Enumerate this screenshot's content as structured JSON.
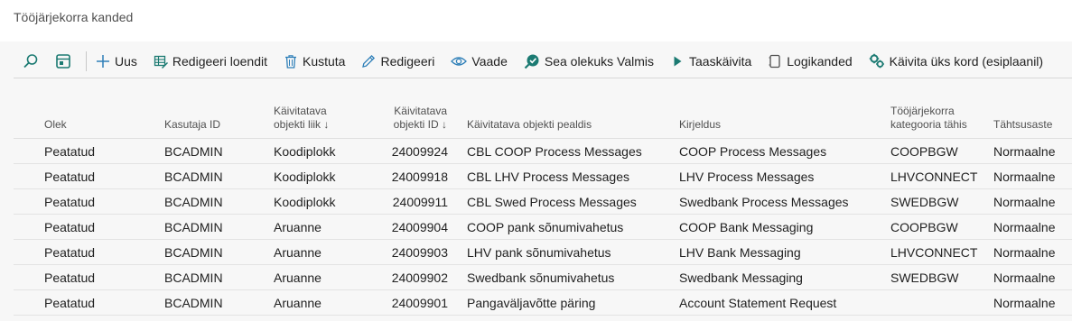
{
  "page": {
    "title": "Tööjärjekorra kanded"
  },
  "toolbar": {
    "search_icon": "search-icon",
    "view_icon": "page-view-icon",
    "buttons": [
      {
        "label": "Uus",
        "icon": "plus-icon"
      },
      {
        "label": "Redigeeri loendit",
        "icon": "edit-list-icon"
      },
      {
        "label": "Kustuta",
        "icon": "trash-icon"
      },
      {
        "label": "Redigeeri",
        "icon": "pencil-icon"
      },
      {
        "label": "Vaade",
        "icon": "eye-icon"
      },
      {
        "label": "Sea olekuks Valmis",
        "icon": "status-ready-icon"
      },
      {
        "label": "Taaskäivita",
        "icon": "play-icon"
      },
      {
        "label": "Logikanded",
        "icon": "log-icon"
      },
      {
        "label": "Käivita üks kord (esiplaanil)",
        "icon": "run-once-icon"
      }
    ]
  },
  "grid": {
    "columns": {
      "status": "Olek",
      "user_id": "Kasutaja ID",
      "object_type_1": "Käivitatava",
      "object_type_2": "objekti liik ↓",
      "object_id_1": "Käivitatava",
      "object_id_2": "objekti ID ↓",
      "object_caption": "Käivitatava objekti pealdis",
      "description": "Kirjeldus",
      "category_1": "Tööjärjekorra",
      "category_2": "kategooria tähis",
      "priority": "Tähtsusaste"
    },
    "rows": [
      {
        "status": "Peatatud",
        "user_id": "BCADMIN",
        "object_type": "Koodiplokk",
        "object_id": "24009924",
        "object_caption": "CBL COOP Process Messages",
        "description": "COOP Process Messages",
        "category": "COOPBGW",
        "priority": "Normaalne"
      },
      {
        "status": "Peatatud",
        "user_id": "BCADMIN",
        "object_type": "Koodiplokk",
        "object_id": "24009918",
        "object_caption": "CBL LHV Process Messages",
        "description": "LHV Process Messages",
        "category": "LHVCONNECT",
        "priority": "Normaalne"
      },
      {
        "status": "Peatatud",
        "user_id": "BCADMIN",
        "object_type": "Koodiplokk",
        "object_id": "24009911",
        "object_caption": "CBL Swed Process Messages",
        "description": "Swedbank Process Messages",
        "category": "SWEDBGW",
        "priority": "Normaalne"
      },
      {
        "status": "Peatatud",
        "user_id": "BCADMIN",
        "object_type": "Aruanne",
        "object_id": "24009904",
        "object_caption": "COOP pank sõnumivahetus",
        "description": "COOP Bank Messaging",
        "category": "COOPBGW",
        "priority": "Normaalne"
      },
      {
        "status": "Peatatud",
        "user_id": "BCADMIN",
        "object_type": "Aruanne",
        "object_id": "24009903",
        "object_caption": "LHV pank sõnumivahetus",
        "description": "LHV Bank Messaging",
        "category": "LHVCONNECT",
        "priority": "Normaalne"
      },
      {
        "status": "Peatatud",
        "user_id": "BCADMIN",
        "object_type": "Aruanne",
        "object_id": "24009902",
        "object_caption": "Swedbank sõnumivahetus",
        "description": "Swedbank Messaging",
        "category": "SWEDBGW",
        "priority": "Normaalne"
      },
      {
        "status": "Peatatud",
        "user_id": "BCADMIN",
        "object_type": "Aruanne",
        "object_id": "24009901",
        "object_caption": "Pangaväljavõtte päring",
        "description": "Account Statement Request",
        "category": "",
        "priority": "Normaalne"
      }
    ]
  },
  "colors": {
    "accent": "#1b7a72",
    "icon_blue": "#2e7fb8",
    "text": "#212121",
    "muted": "#505050"
  }
}
